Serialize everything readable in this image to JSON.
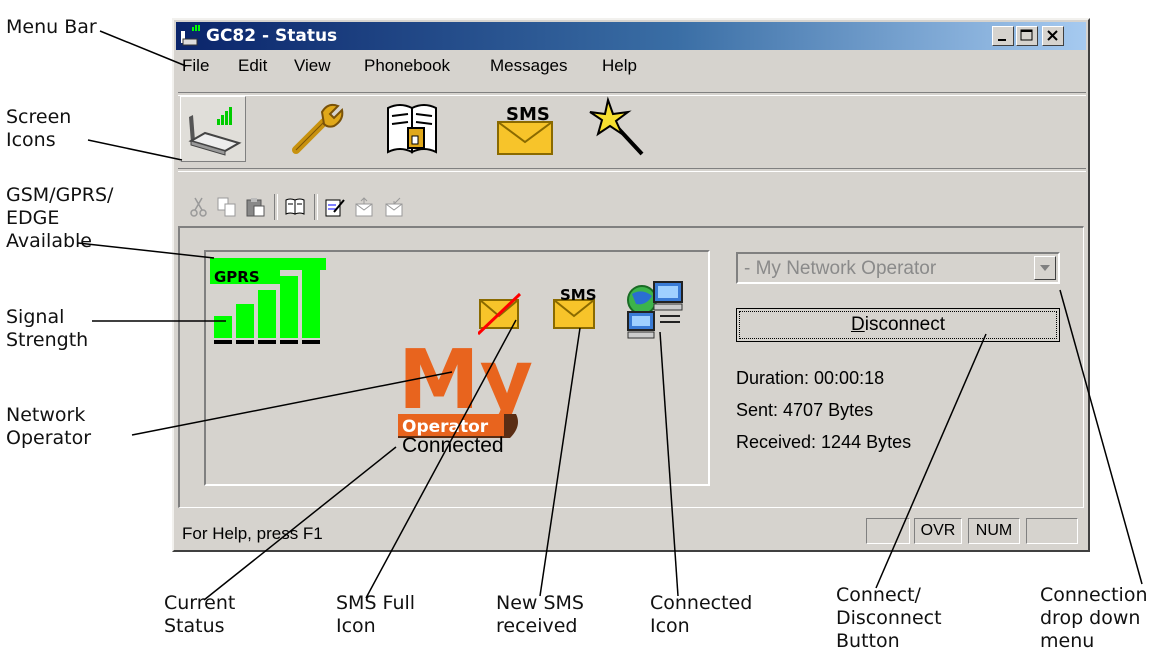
{
  "window": {
    "title": "GC82 - Status",
    "controls": [
      "minimize",
      "maximize",
      "close"
    ]
  },
  "menu": [
    "File",
    "Edit",
    "View",
    "Phonebook",
    "Messages",
    "Help"
  ],
  "screen_icons": [
    {
      "name": "status-icon",
      "selected": true
    },
    {
      "name": "settings-wrench-icon",
      "selected": false
    },
    {
      "name": "phonebook-icon",
      "selected": false
    },
    {
      "name": "sms-icon",
      "selected": false,
      "label": "SMS"
    },
    {
      "name": "wizard-icon",
      "selected": false
    }
  ],
  "toolbar_icons": [
    "cut-icon",
    "copy-icon",
    "paste-icon",
    "phonebook-small-icon",
    "compose-icon",
    "send-icon",
    "receive-icon"
  ],
  "status_panel": {
    "network_type": "GPRS",
    "sms_label": "SMS",
    "operator_logo": {
      "big": "My",
      "sub": "Operator"
    },
    "connection_status": "Connected"
  },
  "connection": {
    "operator_select": "- My Network Operator",
    "button": {
      "prefix": "D",
      "rest": "isconnect"
    },
    "duration": "Duration: 00:00:18",
    "sent": "Sent: 4707 Bytes",
    "received": "Received: 1244 Bytes"
  },
  "statusbar": {
    "help": "For Help, press F1",
    "panels": [
      "",
      "OVR",
      "NUM",
      ""
    ]
  },
  "callouts": {
    "menu_bar": "Menu Bar",
    "screen_icons": "Screen\nIcons",
    "gsm": "GSM/GPRS/\nEDGE\nAvailable",
    "signal": "Signal\nStrength",
    "operator": "Network\nOperator",
    "current_status": "Current\nStatus",
    "sms_full": "SMS Full\nIcon",
    "new_sms": "New SMS\nreceived",
    "connected_icon": "Connected\nIcon",
    "connect_btn": "Connect/\nDisconnect\nButton",
    "drop_down": "Connection\ndrop down\nmenu"
  },
  "colors": {
    "signal": "#00ff00",
    "titlebar": "#0a246a",
    "logo_orange": "#e8641e",
    "logo_brown": "#5a2d14"
  }
}
